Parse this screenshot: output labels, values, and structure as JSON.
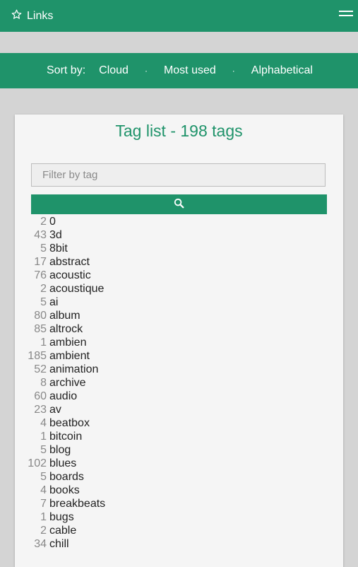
{
  "header": {
    "brand_label": "Links"
  },
  "sort": {
    "label": "Sort by:",
    "options": [
      "Cloud",
      "Most used",
      "Alphabetical"
    ],
    "separator": "·"
  },
  "taglist": {
    "title": "Tag list - 198 tags",
    "filter_placeholder": "Filter by tag",
    "tags": [
      {
        "count": "2",
        "name": "0"
      },
      {
        "count": "43",
        "name": "3d"
      },
      {
        "count": "5",
        "name": "8bit"
      },
      {
        "count": "17",
        "name": "abstract"
      },
      {
        "count": "76",
        "name": "acoustic"
      },
      {
        "count": "2",
        "name": "acoustique"
      },
      {
        "count": "5",
        "name": "ai"
      },
      {
        "count": "80",
        "name": "album"
      },
      {
        "count": "85",
        "name": "altrock"
      },
      {
        "count": "1",
        "name": "ambien"
      },
      {
        "count": "185",
        "name": "ambient"
      },
      {
        "count": "52",
        "name": "animation"
      },
      {
        "count": "8",
        "name": "archive"
      },
      {
        "count": "60",
        "name": "audio"
      },
      {
        "count": "23",
        "name": "av"
      },
      {
        "count": "4",
        "name": "beatbox"
      },
      {
        "count": "1",
        "name": "bitcoin"
      },
      {
        "count": "5",
        "name": "blog"
      },
      {
        "count": "102",
        "name": "blues"
      },
      {
        "count": "5",
        "name": "boards"
      },
      {
        "count": "4",
        "name": "books"
      },
      {
        "count": "7",
        "name": "breakbeats"
      },
      {
        "count": "1",
        "name": "bugs"
      },
      {
        "count": "2",
        "name": "cable"
      },
      {
        "count": "34",
        "name": "chill"
      }
    ]
  },
  "icons": {
    "brand": "star-outline-icon",
    "menu": "hamburger-menu-icon",
    "search": "search-icon"
  },
  "colors": {
    "accent": "#1f936a",
    "background": "#d4d4d4",
    "card": "#f5f5f5"
  }
}
